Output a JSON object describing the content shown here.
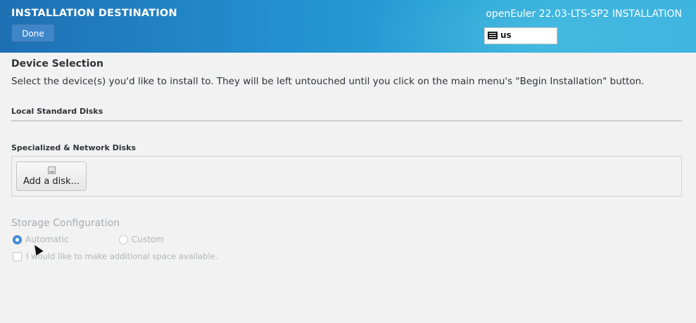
{
  "header": {
    "title": "INSTALLATION DESTINATION",
    "done_label": "Done",
    "product": "openEuler 22.03-LTS-SP2 INSTALLATION",
    "keyboard_layout": "us",
    "colors": {
      "gradient_start": "#1e6fb3",
      "gradient_end": "#3cb3df",
      "done_button": "#3f86c9"
    }
  },
  "device_selection": {
    "title": "Device Selection",
    "instructions": "Select the device(s) you'd like to install to.  They will be left untouched until you click on the main menu's \"Begin Installation\" button."
  },
  "local_disks": {
    "heading": "Local Standard Disks"
  },
  "network_disks": {
    "heading": "Specialized & Network Disks",
    "add_disk_label": "Add a disk..."
  },
  "storage_configuration": {
    "title": "Storage Configuration",
    "options": [
      {
        "label": "Automatic",
        "selected": true
      },
      {
        "label": "Custom",
        "selected": false
      }
    ],
    "additional_space_label": "I would like to make additional space available.",
    "additional_space_checked": false
  }
}
